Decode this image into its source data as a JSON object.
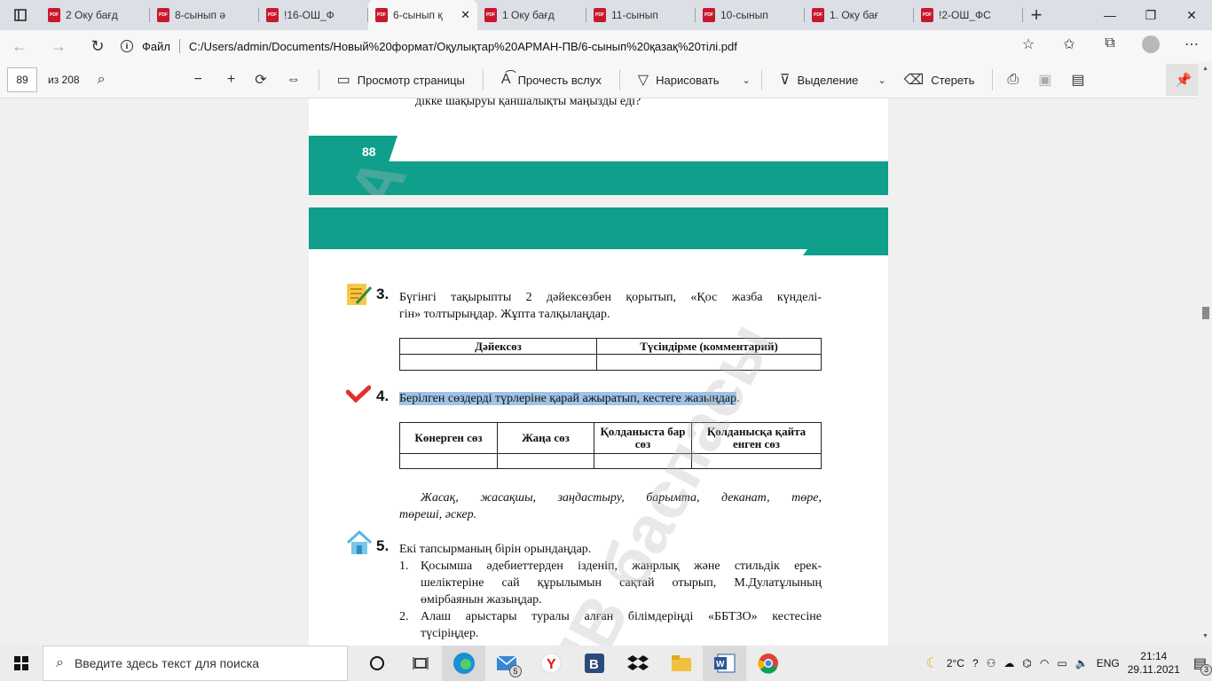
{
  "tabs": [
    {
      "title": "2 Оку бағд"
    },
    {
      "title": "8-сынып ә"
    },
    {
      "title": "!16-ОШ_Ф"
    },
    {
      "title": "6-сынып қ",
      "active": true
    },
    {
      "title": "1 Оку бағд"
    },
    {
      "title": "11-сынып"
    },
    {
      "title": "10-сынып"
    },
    {
      "title": "1. Оку бағ"
    },
    {
      "title": "!2-ОШ_ФС"
    }
  ],
  "address": {
    "label": "Файл",
    "url": "C:/Users/admin/Documents/Новый%20формат/Оқулықтар%20АРМАН-ПВ/6-сынып%20қазақ%20тілі.pdf"
  },
  "pdf_toolbar": {
    "page": "89",
    "of": "из 208",
    "view": "Просмотр страницы",
    "read": "Прочесть вслух",
    "draw": "Нарисовать",
    "highlight": "Выделение",
    "erase": "Стереть"
  },
  "page1": {
    "question_tail": "дікке шақыруы қаншалықты маңызды еді?",
    "page_number": "88"
  },
  "watermark": {
    "top": "А",
    "bottom": "ПВ баспасы"
  },
  "task3": {
    "num": "3.",
    "line1": "Бүгінгі тақырыпты 2 дәйексөзбен қорытып, «Қос жазба күнделі-",
    "line2": "гін» толтырыңдар. Жұпта талқылаңдар.",
    "col1": "Дәйексөз",
    "col2": "Түсіндірме (комментарий)"
  },
  "task4": {
    "num": "4.",
    "text": "Берілген сөздерді түрлеріне қарай ажыратып, кестеге жазыңдар",
    "end": ".",
    "cols": [
      "Көнерген сөз",
      "Жаңа сөз",
      "Қолданыста бар сөз",
      "Қолданысқа қайта енген сөз"
    ],
    "words1": "Жасақ, жасақшы, заңдастыру, барымта, деканат, төре,",
    "words2": "төреші, әскер."
  },
  "task5": {
    "num": "5.",
    "intro": "Екі тапсырманың бірін орындаңдар.",
    "i1n": "1.",
    "i1a": "Қосымша әдебиеттерден ізденіп, жанрлық және стильдік ерек-",
    "i1b": "шеліктеріне сай құрылымын сақтай отырып, М.Дулатұлының",
    "i1c": "өмірбаянын жазыңдар.",
    "i2n": "2.",
    "i2a": "Алаш арыстары туралы алған білімдеріңді «ББТЗО» кестесіне",
    "i2b": "түсіріңдер."
  },
  "taskbar": {
    "search": "Введите здесь текст для поиска",
    "mail_badge": "5",
    "temp": "2°C",
    "lang": "ENG",
    "time": "21:14",
    "date": "29.11.2021",
    "notif": "3"
  },
  "colors": {
    "teal": "#0f9f8b",
    "highlight": "#9fc3e6",
    "pdf_red": "#c8182e"
  }
}
